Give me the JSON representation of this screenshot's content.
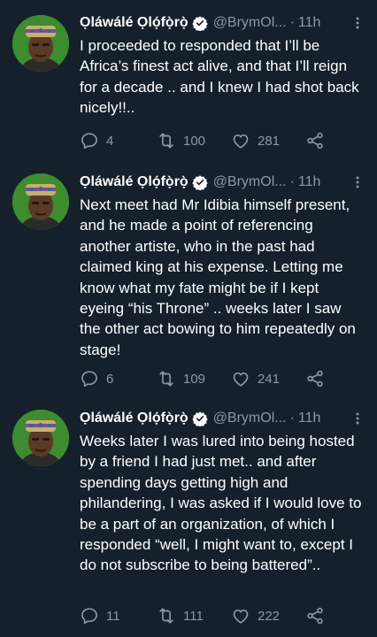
{
  "tweets": [
    {
      "author": "Ọláwálé Ọlọ́fọ̀rọ̀",
      "handle": "@BrymOl...",
      "separator": "·",
      "time": "11h",
      "text": "I proceeded to responded that I’ll be Africa’s finest act alive, and that I’ll reign for a decade .. and I knew I had shot back nicely!!..",
      "replies": "4",
      "retweets": "100",
      "likes": "281"
    },
    {
      "author": "Ọláwálé Ọlọ́fọ̀rọ̀",
      "handle": "@BrymOl...",
      "separator": "·",
      "time": "11h",
      "text": "Next meet had Mr Idibia himself present, and he made a point of referencing another artiste, who in the past had claimed king at his expense. Letting me know what my fate might be if I kept eyeing “his Throne” .. weeks later I saw the other act bowing to him repeatedly on stage!",
      "replies": "6",
      "retweets": "109",
      "likes": "241"
    },
    {
      "author": "Ọláwálé Ọlọ́fọ̀rọ̀",
      "handle": "@BrymOl...",
      "separator": "·",
      "time": "11h",
      "text": "Weeks later I was lured into being hosted by a friend I had just met.. and after spending days getting high and philandering, I was asked if I would love to be a part of an organization, of which I responded “well, I might want to, except I do not subscribe to being battered”..",
      "replies": "11",
      "retweets": "111",
      "likes": "222"
    }
  ],
  "colors": {
    "background": "#15202b",
    "muted": "#8899a6",
    "verified": "#1d9bf0"
  },
  "icons": [
    "reply-icon",
    "retweet-icon",
    "like-icon",
    "share-icon",
    "verified-icon",
    "more-icon"
  ]
}
